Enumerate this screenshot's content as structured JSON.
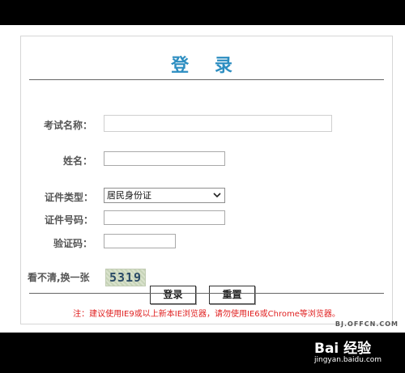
{
  "page": {
    "title": "登 录"
  },
  "form": {
    "exam_name_label": "考试名称：",
    "exam_name_value": "",
    "name_label": "姓名：",
    "name_value": "",
    "id_type_label": "证件类型：",
    "id_type_selected": "居民身份证",
    "id_number_label": "证件号码：",
    "id_number_value": "",
    "verify_label": "验证码：",
    "verify_value": "",
    "captcha_refresh_label": "看不清,换一张",
    "captcha_text": "5319"
  },
  "buttons": {
    "login": "登录",
    "reset": "重置"
  },
  "notice": "注：建议使用IE9或以上新本IE浏览器，请勿使用IE6或Chrome等浏览器。",
  "watermark": {
    "site": "BJ.OFFCN.COM",
    "logo": "Bai 经验",
    "url": "jingyan.baidu.com"
  },
  "colors": {
    "title": "#2d8ec1",
    "notice": "#e02020",
    "background": "#000000"
  }
}
